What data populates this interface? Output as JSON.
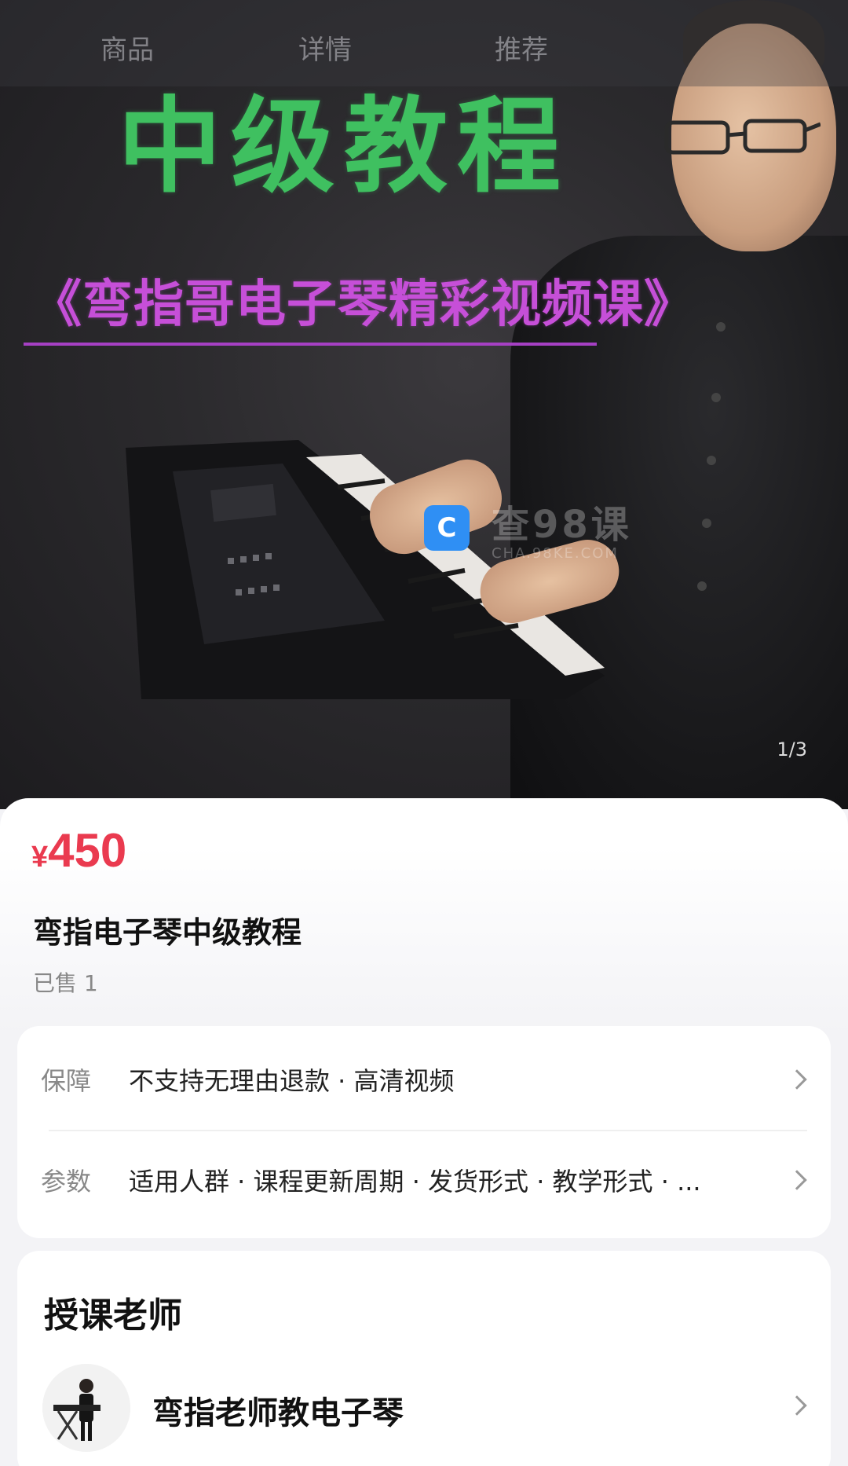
{
  "nav": {
    "tabs": [
      "商品",
      "详情",
      "推荐"
    ]
  },
  "hero": {
    "title": "中级教程",
    "subtitle": "《弯指哥电子琴精彩视频课》",
    "pager": "1/3",
    "watermark_big": "查98课",
    "watermark_small": "CHA.98KE.COM"
  },
  "product": {
    "currency": "¥",
    "price": "450",
    "title": "弯指电子琴中级教程",
    "sold": "已售 1"
  },
  "attributes": [
    {
      "label": "保障",
      "value": "不支持无理由退款 · 高清视频"
    },
    {
      "label": "参数",
      "value": "适用人群 · 课程更新周期 · 发货形式 · 教学形式 · ..."
    }
  ],
  "teacher": {
    "heading": "授课老师",
    "name": "弯指老师教电子琴"
  },
  "colors": {
    "price": "#ea3a4f",
    "hero_title": "#3fc060",
    "hero_subtitle": "#c64fd8"
  }
}
